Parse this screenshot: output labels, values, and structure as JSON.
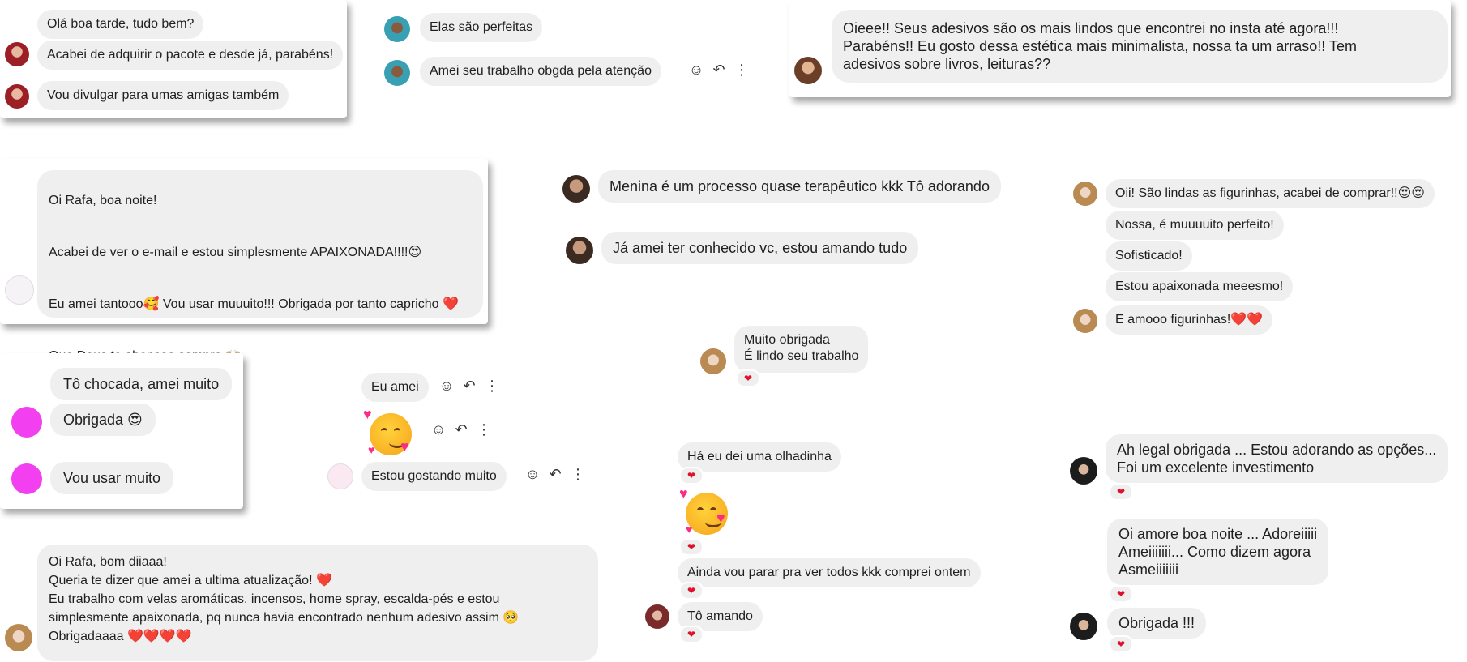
{
  "chat1": {
    "m1": "Olá boa tarde, tudo bem?",
    "m2": "Acabei de adquirir o pacote e desde já, parabéns!",
    "m3": "Vou divulgar para umas amigas também"
  },
  "chat2": {
    "m1": "Elas são perfeitas",
    "m2": "Amei seu trabalho obgda pela atenção"
  },
  "chat3": {
    "m1": "Oieee!! Seus adesivos são os mais lindos que encontrei no insta até agora!!!\nParabéns!! Eu gosto dessa estética mais minimalista, nossa ta um arraso!! Tem\nadesivos sobre livros, leituras??"
  },
  "chat4": {
    "m1": "Oi Rafa, boa noite!",
    "m2": "Acabei de ver o e-mail e estou simplesmente APAIXONADA!!!!😍",
    "m3": "Eu amei tantooo🥰 Vou usar muuuito!!! Obrigada por tanto capricho ❤️",
    "m4": "Que Deus te abençoe sempre 🙌🏼"
  },
  "chat5": {
    "m1": "Menina é um processo quase terapêutico kkk Tô adorando",
    "m2": "Já amei ter conhecido vc, estou amando tudo"
  },
  "chat6": {
    "m1": "Oii! São lindas as figurinhas, acabei de comprar!!😍😍",
    "m2": "Nossa, é muuuuito perfeito!",
    "m3": "Sofisticado!",
    "m4": "Estou apaixonada meeesmo!",
    "m5": "E amooo figurinhas!❤️❤️"
  },
  "chat7": {
    "m1": "Muito obrigada\nÉ lindo seu trabalho",
    "reaction": "❤"
  },
  "chat8": {
    "m1": "Tô chocada, amei muito",
    "m2": "Obrigada 😍",
    "m3": "Vou usar muito"
  },
  "chat9": {
    "m1": "Eu amei",
    "m2": "Estou gostando muito"
  },
  "chat10": {
    "m1": "Há eu dei uma olhadinha",
    "m2": "Ainda vou parar pra ver todos kkk comprei ontem",
    "m3": "Tô amando",
    "reaction": "❤"
  },
  "chat11": {
    "m1": "Ah legal obrigada ... Estou adorando as opções...\nFoi um excelente investimento",
    "m2": "Oi amore boa noite ... Adoreiiiii\nAmeiiiiiii... Como dizem agora\nAsmeiiiiiii",
    "m3": "Obrigada !!!",
    "reaction": "❤"
  },
  "chat12": {
    "m1": "Oi Rafa, bom diiaaa!\nQueria te dizer que amei a ultima atualização! ❤️\nEu trabalho com velas aromáticas, incensos, home spray, escalda-pés e estou\nsimplesmente apaixonada, pq nunca havia encontrado nenhum adesivo assim 🥺\nObrigadaaaa ❤️❤️❤️❤️"
  },
  "icons": {
    "smile": "☺",
    "reply": "↶",
    "more": "⋮"
  }
}
